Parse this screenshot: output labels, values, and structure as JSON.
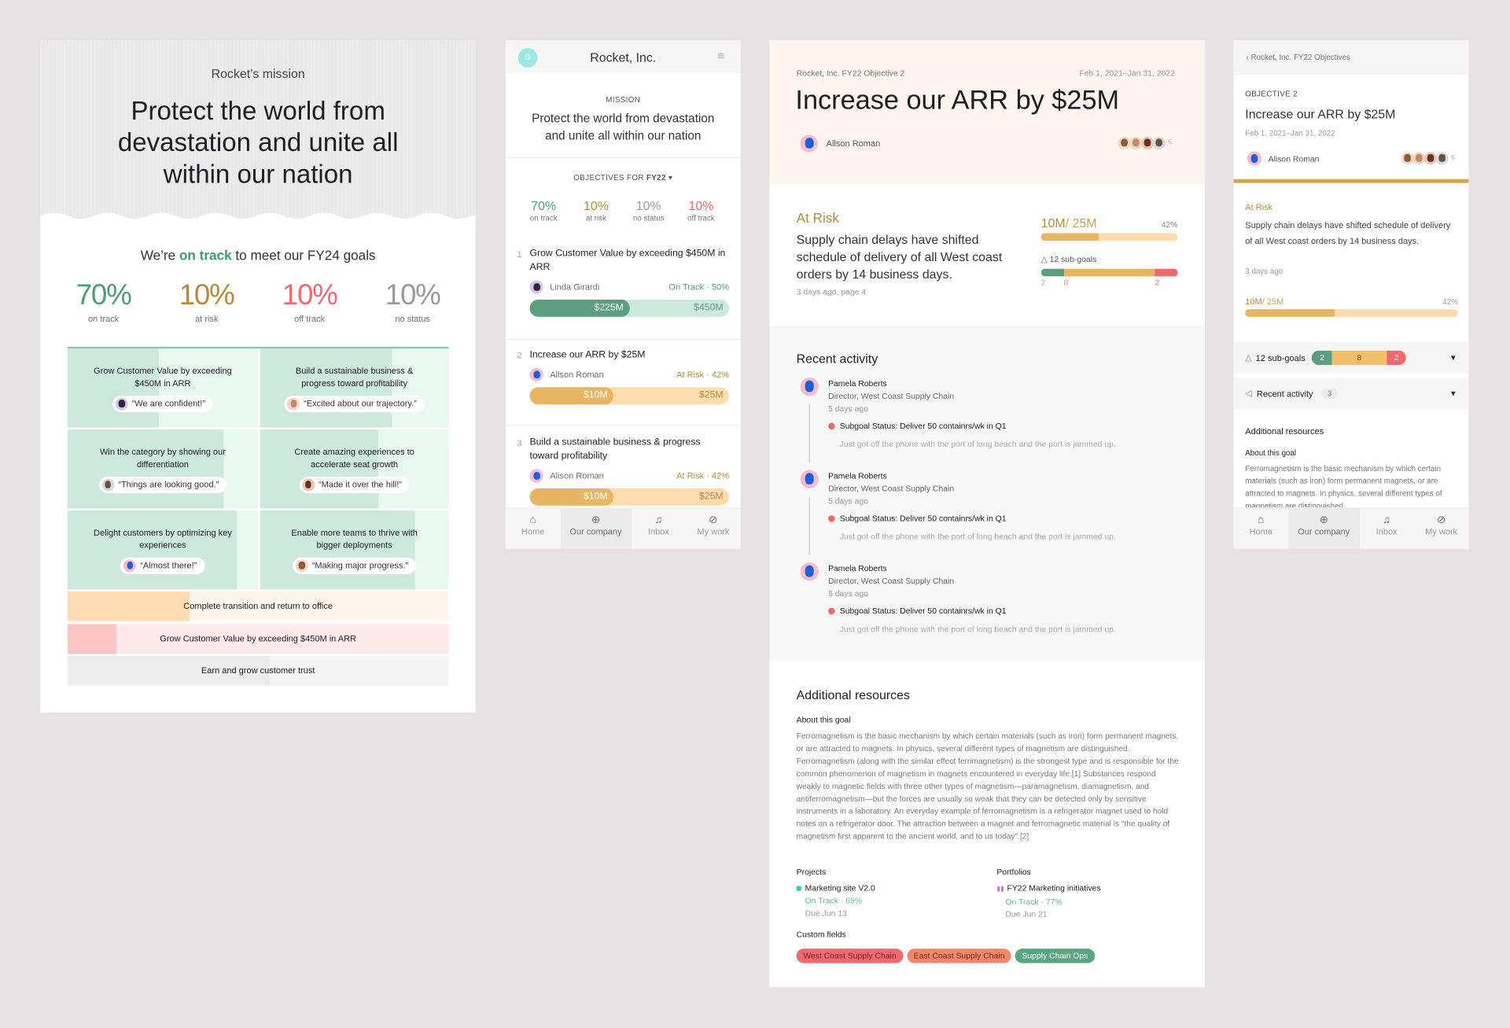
{
  "colors": {
    "on_track": "#4f9d78",
    "at_risk": "#e8b563",
    "off_track": "#ef6a6e",
    "no_status": "#9a9a9a",
    "background": "#e7e3e4"
  },
  "poster": {
    "kicker": "Rocket’s mission",
    "mission": [
      "Protect the world from",
      "devastation and unite all",
      "within our nation"
    ],
    "headline_pre": "We’re ",
    "headline_em": "on track",
    "headline_post": " to meet our FY24 goals",
    "stats": [
      {
        "value": "70%",
        "label": "on track"
      },
      {
        "value": "10%",
        "label": "at risk"
      },
      {
        "value": "10%",
        "label": "off track"
      },
      {
        "value": "10%",
        "label": "no status"
      }
    ],
    "tiles": [
      {
        "title": "Grow Customer Value by exceeding $450M in ARR",
        "quote": "“We are confident!”",
        "progress": 0.48
      },
      {
        "title": "Build a sustainable business & progress toward profitability",
        "quote": "“Excited about our trajectory.”",
        "progress": 0.7
      },
      {
        "title": "Win the category by showing our differentiation",
        "quote": "“Things are looking good.”",
        "progress": 0.82
      },
      {
        "title": "Create amazing experiences to accelerate seat growth",
        "quote": "“Made it over the hill!”",
        "progress": 0.63
      },
      {
        "title": "Delight customers by optimizing key experiences",
        "quote": "“Almost there!”",
        "progress": 0.89
      },
      {
        "title": "Enable more teams to thrive with bigger deployments",
        "quote": "“Making major progress.”",
        "progress": 0.82
      }
    ],
    "bars": [
      {
        "title": "Complete transition and return to office",
        "progress": 0.32,
        "status": "at_risk"
      },
      {
        "title": "Grow Customer Value by exceeding $450M in ARR",
        "progress": 0.13,
        "status": "off_track"
      },
      {
        "title": "Earn and grow customer trust",
        "progress": 0.53,
        "status": "no_status"
      }
    ]
  },
  "mobile_list": {
    "title": "Rocket, Inc.",
    "mission_label": "MISSION",
    "mission": [
      "Protect the world from devastation",
      "and unite all within our nation"
    ],
    "objectives_for": "OBJECTIVES FOR ",
    "period": "FY22",
    "stats": [
      {
        "value": "70%",
        "label": "on track"
      },
      {
        "value": "10%",
        "label": "at risk"
      },
      {
        "value": "10%",
        "label": "no status"
      },
      {
        "value": "10%",
        "label": "off track"
      }
    ],
    "objectives": [
      {
        "num": "1",
        "title": "Grow Customer Value by exceeding $450M in ARR",
        "owner": "Linda Girardi",
        "status": "On Track · 50%",
        "current": "$225M",
        "target": "$450M",
        "progress": 0.5,
        "kind": "on"
      },
      {
        "num": "2",
        "title": "Increase our ARR by $25M",
        "owner": "Alison Roman",
        "status": "At Risk · 42%",
        "current": "$10M",
        "target": "$25M",
        "progress": 0.42,
        "kind": "risk"
      },
      {
        "num": "3",
        "title": "Build a sustainable business & progress toward profitability",
        "owner": "Alison Roman",
        "status": "At Risk · 42%",
        "current": "$10M",
        "target": "$25M",
        "progress": 0.42,
        "kind": "risk"
      }
    ]
  },
  "nav": [
    {
      "label": "Home",
      "icon": "home-icon",
      "glyph": "⌂"
    },
    {
      "label": "Our company",
      "icon": "globe-icon",
      "glyph": "⊕"
    },
    {
      "label": "Inbox",
      "icon": "bell-icon",
      "glyph": "♫"
    },
    {
      "label": "My work",
      "icon": "check-circle-icon",
      "glyph": "⊘"
    }
  ],
  "detail": {
    "breadcrumb": "Rocket, Inc. FY22 Objective 2",
    "dates": "Feb 1, 2021–Jan 31, 2022",
    "title": "Increase our ARR by $25M",
    "owner": "Alison Roman",
    "collaborator_count": "5",
    "status": "At Risk",
    "status_text": "Supply chain delays have shifted schedule of delivery of all West coast orders by 14 business days.",
    "status_meta": "3 days ago, page 4",
    "current": "10M",
    "target": " / 25M",
    "percent": "42%",
    "progress": 0.42,
    "subgoals_label": "12 sub-goals",
    "subgoals": {
      "on_track": 2,
      "at_risk": 8,
      "off_track": 2
    },
    "recent_title": "Recent activity",
    "activity": [
      {
        "name": "Pamela Roberts",
        "role": "Director, West Coast Supply Chain",
        "time": "5 days ago",
        "subgoal": "Subgoal Status: Deliver 50 containrs/wk in Q1",
        "comment": "Just got off the phone with the port of long beach and the port is jammed up."
      },
      {
        "name": "Pamela Roberts",
        "role": "Director, West Coast Supply Chain",
        "time": "5 days ago",
        "subgoal": "Subgoal Status: Deliver 50 containrs/wk in Q1",
        "comment": "Just got off the phone with the port of long beach and the port is jammed up."
      },
      {
        "name": "Pamela Roberts",
        "role": "Director, West Coast Supply Chain",
        "time": "5 days ago",
        "subgoal": "Subgoal Status: Deliver 50 containrs/wk in Q1",
        "comment": "Just got off the phone with the port of long beach and the port is jammed up."
      }
    ],
    "resources_title": "Additional resources",
    "about_label": "About this goal",
    "about": "Ferromagnetism is the basic mechanism by which certain materials (such as iron) form permanent magnets, or are attracted to magnets. In physics, several different types of magnetism are distinguished. Ferromagnetism (along with the similar effect ferrimagnetism) is the strongest type and is responsible for the common phenomenon of magnetism in magnets encountered in everyday life.[1] Substances respond weakly to magnetic fields with three other types of magnetism—paramagnetism, diamagnetism, and antiferromagnetism—but the forces are usually so weak that they can be detected only by sensitive instruments in a laboratory. An everyday example of ferromagnetism is a refrigerator magnet used to hold notes on a refrigerator door. The attraction between a magnet and ferromagnetic material is \"the quality of magnetism first apparent to the ancient world, and to us today\".[2]",
    "projects_label": "Projects",
    "project": {
      "name": "Marketing site V2.0",
      "status": "On Track · 65%",
      "due": "Due Jun 13"
    },
    "portfolios_label": "Portfolios",
    "portfolio": {
      "name": "FY22 Marketing initiatives",
      "status": "On Track · 77%",
      "due": "Due Jun 21"
    },
    "custom_fields_label": "Custom fields",
    "custom_fields": [
      {
        "label": "West Coast Supply Chain",
        "color": "#ef6a6e"
      },
      {
        "label": "East Coast Supply Chain",
        "color": "#f0896a"
      },
      {
        "label": "Supply Chain Ops",
        "color": "#5aa47f"
      }
    ]
  },
  "mobile_detail": {
    "back": "Rocket, Inc. FY22 Objectives",
    "kicker": "OBJECTIVE 2",
    "title": "Increase our ARR by $25M",
    "dates": "Feb 1, 2021–Jan 31, 2022",
    "owner": "Alison Roman",
    "collaborator_count": "5",
    "status": "At Risk",
    "status_text": "Supply chain delays have shifted schedule of delivery of all West coast orders by 14 business days.",
    "status_meta": "3 days ago",
    "current": "10M",
    "target": " / 25M",
    "percent": "42%",
    "subgoals_label": "12 sub-goals",
    "recent_label": "Recent activity",
    "recent_count": "3",
    "resources_title": "Additional resources",
    "about_label": "About this goal",
    "about": "Ferromagnetism is the basic mechanism by which certain materials (such as iron) form permanent magnets, or are attracted to magnets. In physics, several different types of magnetism are distinguished."
  }
}
